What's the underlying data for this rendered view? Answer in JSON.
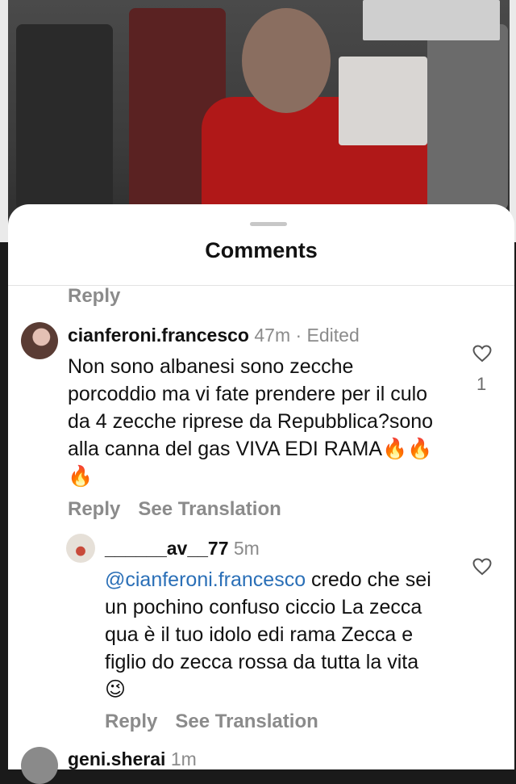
{
  "sheet": {
    "title": "Comments",
    "top_reply_label": "Reply"
  },
  "comments": [
    {
      "username": "cianferoni.francesco",
      "time": "47m · Edited",
      "text": "Non sono albanesi sono zecche porcoddio ma vi fate prendere per il culo da 4 zecche riprese da Repubblica?sono alla canna del gas VIVA EDI RAMA🔥🔥🔥",
      "reply_label": "Reply",
      "translate_label": "See Translation",
      "like_count": "1",
      "icon": "heart-icon"
    }
  ],
  "replies": [
    {
      "username": "______av__77",
      "time": "5m",
      "mention": "@cianferoni.francesco",
      "text": " credo che sei un pochino confuso ciccio La zecca qua è il tuo idolo edi rama Zecca e figlio do zecca rossa da tutta la vita 😉",
      "reply_label": "Reply",
      "translate_label": "See Translation",
      "icon": "heart-icon"
    }
  ],
  "next_comment": {
    "username": "geni.sherai",
    "time": "1m"
  },
  "colors": {
    "mention": "#2a6fb7",
    "secondary_text": "#8b8b8b",
    "sheet_background": "#ffffff"
  }
}
